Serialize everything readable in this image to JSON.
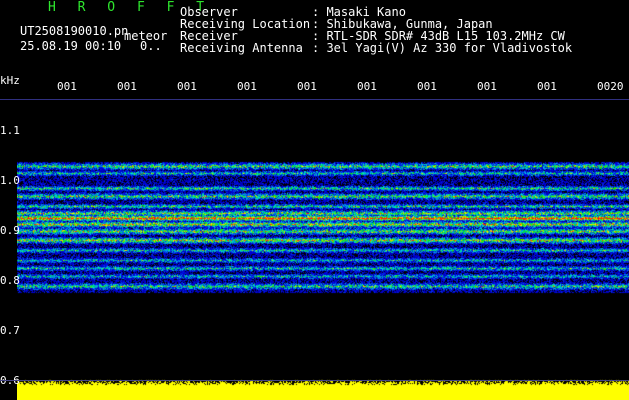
{
  "header": {
    "app_name": "H R O F F T",
    "filename": "UT2508190010.pn",
    "mode": "meteor",
    "datetime": "25.08.19 00:10",
    "status": "0..",
    "fields": [
      {
        "label": "Observer",
        "value": ": Masaki Kano"
      },
      {
        "label": "Receiving Location",
        "value": ": Shibukawa, Gunma, Japan"
      },
      {
        "label": "Receiver",
        "value": ": RTL-SDR SDR# 43dB L15 103.2MHz CW"
      },
      {
        "label": "Receiving Antenna",
        "value": ": 3el Yagi(V) Az 330 for Vladivostok"
      }
    ]
  },
  "axis": {
    "unit": "kHz",
    "y_labels": [
      "1.1",
      "1.0",
      "0.9",
      "0.8",
      "0.7",
      "0.6"
    ],
    "x_ticks": [
      "001",
      "001",
      "001",
      "001",
      "001",
      "001",
      "001",
      "001",
      "001",
      "0020"
    ]
  },
  "colors": {
    "background": "#000000",
    "title_green": "#2ee62e",
    "signal_red": "#ff2020",
    "level_yellow": "#ffff00"
  }
}
